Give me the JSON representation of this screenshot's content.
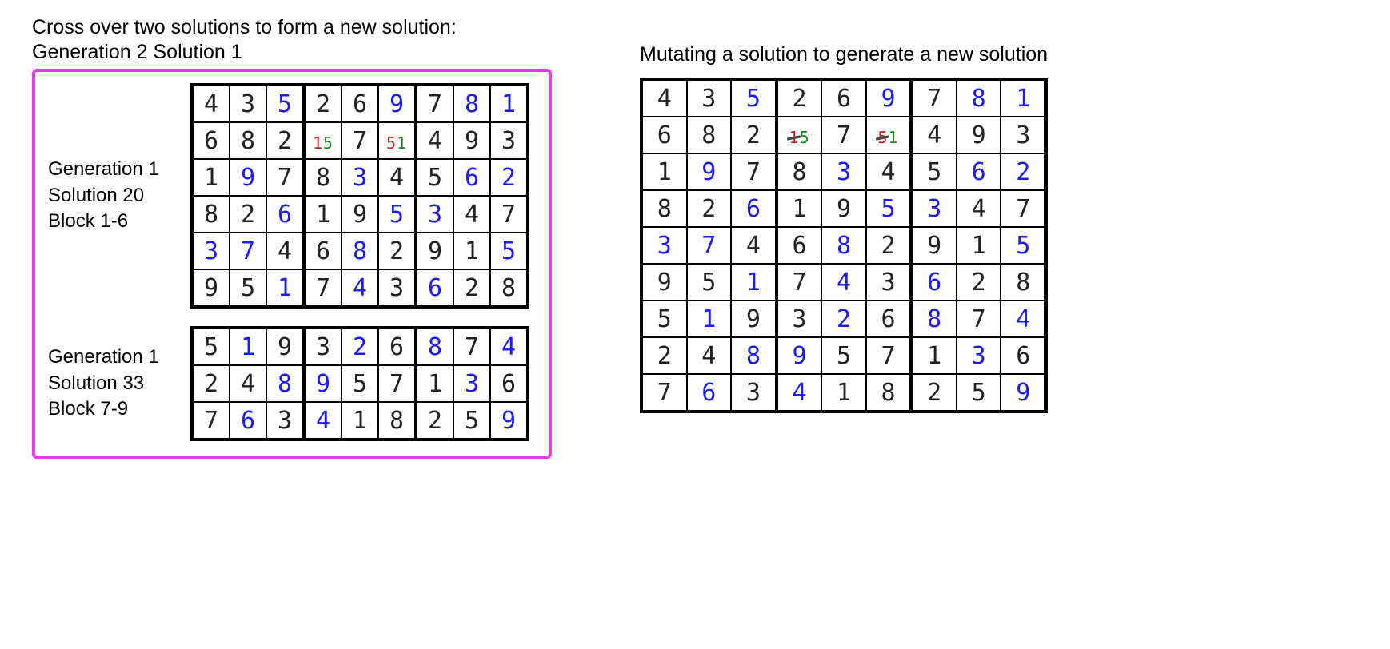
{
  "left": {
    "caption_line1": "Cross over two solutions to form a new solution:",
    "caption_line2": "Generation 2 Solution 1",
    "partA": {
      "label_l1": "Generation 1",
      "label_l2": "Solution 20",
      "label_l3": "Block 1-6",
      "rows": [
        [
          {
            "v": "4",
            "c": "k"
          },
          {
            "v": "3",
            "c": "k"
          },
          {
            "v": "5",
            "c": "b"
          },
          {
            "v": "2",
            "c": "k"
          },
          {
            "v": "6",
            "c": "k"
          },
          {
            "v": "9",
            "c": "b"
          },
          {
            "v": "7",
            "c": "k"
          },
          {
            "v": "8",
            "c": "b"
          },
          {
            "v": "1",
            "c": "b"
          }
        ],
        [
          {
            "v": "6",
            "c": "k"
          },
          {
            "v": "8",
            "c": "k"
          },
          {
            "v": "2",
            "c": "k"
          },
          {
            "mix": [
              {
                "t": "1",
                "c": "red"
              },
              {
                "t": "5",
                "c": "grn"
              }
            ]
          },
          {
            "v": "7",
            "c": "k"
          },
          {
            "mix": [
              {
                "t": "5",
                "c": "red"
              },
              {
                "t": "1",
                "c": "grn"
              }
            ]
          },
          {
            "v": "4",
            "c": "k"
          },
          {
            "v": "9",
            "c": "k"
          },
          {
            "v": "3",
            "c": "k"
          }
        ],
        [
          {
            "v": "1",
            "c": "k"
          },
          {
            "v": "9",
            "c": "b"
          },
          {
            "v": "7",
            "c": "k"
          },
          {
            "v": "8",
            "c": "k"
          },
          {
            "v": "3",
            "c": "b"
          },
          {
            "v": "4",
            "c": "k"
          },
          {
            "v": "5",
            "c": "k"
          },
          {
            "v": "6",
            "c": "b"
          },
          {
            "v": "2",
            "c": "b"
          }
        ],
        [
          {
            "v": "8",
            "c": "k"
          },
          {
            "v": "2",
            "c": "k"
          },
          {
            "v": "6",
            "c": "b"
          },
          {
            "v": "1",
            "c": "k"
          },
          {
            "v": "9",
            "c": "k"
          },
          {
            "v": "5",
            "c": "b"
          },
          {
            "v": "3",
            "c": "b"
          },
          {
            "v": "4",
            "c": "k"
          },
          {
            "v": "7",
            "c": "k"
          }
        ],
        [
          {
            "v": "3",
            "c": "b"
          },
          {
            "v": "7",
            "c": "b"
          },
          {
            "v": "4",
            "c": "k"
          },
          {
            "v": "6",
            "c": "k"
          },
          {
            "v": "8",
            "c": "b"
          },
          {
            "v": "2",
            "c": "k"
          },
          {
            "v": "9",
            "c": "k"
          },
          {
            "v": "1",
            "c": "k"
          },
          {
            "v": "5",
            "c": "b"
          }
        ],
        [
          {
            "v": "9",
            "c": "k"
          },
          {
            "v": "5",
            "c": "k"
          },
          {
            "v": "1",
            "c": "b"
          },
          {
            "v": "7",
            "c": "k"
          },
          {
            "v": "4",
            "c": "b"
          },
          {
            "v": "3",
            "c": "k"
          },
          {
            "v": "6",
            "c": "b"
          },
          {
            "v": "2",
            "c": "k"
          },
          {
            "v": "8",
            "c": "k"
          }
        ]
      ]
    },
    "partB": {
      "label_l1": "Generation 1",
      "label_l2": "Solution 33",
      "label_l3": "Block 7-9",
      "rows": [
        [
          {
            "v": "5",
            "c": "k"
          },
          {
            "v": "1",
            "c": "b"
          },
          {
            "v": "9",
            "c": "k"
          },
          {
            "v": "3",
            "c": "k"
          },
          {
            "v": "2",
            "c": "b"
          },
          {
            "v": "6",
            "c": "k"
          },
          {
            "v": "8",
            "c": "b"
          },
          {
            "v": "7",
            "c": "k"
          },
          {
            "v": "4",
            "c": "b"
          }
        ],
        [
          {
            "v": "2",
            "c": "k"
          },
          {
            "v": "4",
            "c": "k"
          },
          {
            "v": "8",
            "c": "b"
          },
          {
            "v": "9",
            "c": "b"
          },
          {
            "v": "5",
            "c": "k"
          },
          {
            "v": "7",
            "c": "k"
          },
          {
            "v": "1",
            "c": "k"
          },
          {
            "v": "3",
            "c": "b"
          },
          {
            "v": "6",
            "c": "k"
          }
        ],
        [
          {
            "v": "7",
            "c": "k"
          },
          {
            "v": "6",
            "c": "b"
          },
          {
            "v": "3",
            "c": "k"
          },
          {
            "v": "4",
            "c": "b"
          },
          {
            "v": "1",
            "c": "k"
          },
          {
            "v": "8",
            "c": "k"
          },
          {
            "v": "2",
            "c": "k"
          },
          {
            "v": "5",
            "c": "k"
          },
          {
            "v": "9",
            "c": "b"
          }
        ]
      ]
    }
  },
  "right": {
    "caption": "Mutating a solution to generate a new solution",
    "rows": [
      [
        {
          "v": "4",
          "c": "k"
        },
        {
          "v": "3",
          "c": "k"
        },
        {
          "v": "5",
          "c": "b"
        },
        {
          "v": "2",
          "c": "k"
        },
        {
          "v": "6",
          "c": "k"
        },
        {
          "v": "9",
          "c": "b"
        },
        {
          "v": "7",
          "c": "k"
        },
        {
          "v": "8",
          "c": "b"
        },
        {
          "v": "1",
          "c": "b"
        }
      ],
      [
        {
          "v": "6",
          "c": "k"
        },
        {
          "v": "8",
          "c": "k"
        },
        {
          "v": "2",
          "c": "k"
        },
        {
          "mix": [
            {
              "t": "1",
              "c": "red",
              "strike": true
            },
            {
              "t": "5",
              "c": "grn"
            }
          ]
        },
        {
          "v": "7",
          "c": "k"
        },
        {
          "mix": [
            {
              "t": "5",
              "c": "red",
              "strike": true
            },
            {
              "t": "1",
              "c": "grn"
            }
          ]
        },
        {
          "v": "4",
          "c": "k"
        },
        {
          "v": "9",
          "c": "k"
        },
        {
          "v": "3",
          "c": "k"
        }
      ],
      [
        {
          "v": "1",
          "c": "k"
        },
        {
          "v": "9",
          "c": "b"
        },
        {
          "v": "7",
          "c": "k"
        },
        {
          "v": "8",
          "c": "k"
        },
        {
          "v": "3",
          "c": "b"
        },
        {
          "v": "4",
          "c": "k"
        },
        {
          "v": "5",
          "c": "k"
        },
        {
          "v": "6",
          "c": "b"
        },
        {
          "v": "2",
          "c": "b"
        }
      ],
      [
        {
          "v": "8",
          "c": "k"
        },
        {
          "v": "2",
          "c": "k"
        },
        {
          "v": "6",
          "c": "b"
        },
        {
          "v": "1",
          "c": "k"
        },
        {
          "v": "9",
          "c": "k"
        },
        {
          "v": "5",
          "c": "b"
        },
        {
          "v": "3",
          "c": "b"
        },
        {
          "v": "4",
          "c": "k"
        },
        {
          "v": "7",
          "c": "k"
        }
      ],
      [
        {
          "v": "3",
          "c": "b"
        },
        {
          "v": "7",
          "c": "b"
        },
        {
          "v": "4",
          "c": "k"
        },
        {
          "v": "6",
          "c": "k"
        },
        {
          "v": "8",
          "c": "b"
        },
        {
          "v": "2",
          "c": "k"
        },
        {
          "v": "9",
          "c": "k"
        },
        {
          "v": "1",
          "c": "k"
        },
        {
          "v": "5",
          "c": "b"
        }
      ],
      [
        {
          "v": "9",
          "c": "k"
        },
        {
          "v": "5",
          "c": "k"
        },
        {
          "v": "1",
          "c": "b"
        },
        {
          "v": "7",
          "c": "k"
        },
        {
          "v": "4",
          "c": "b"
        },
        {
          "v": "3",
          "c": "k"
        },
        {
          "v": "6",
          "c": "b"
        },
        {
          "v": "2",
          "c": "k"
        },
        {
          "v": "8",
          "c": "k"
        }
      ],
      [
        {
          "v": "5",
          "c": "k"
        },
        {
          "v": "1",
          "c": "b"
        },
        {
          "v": "9",
          "c": "k"
        },
        {
          "v": "3",
          "c": "k"
        },
        {
          "v": "2",
          "c": "b"
        },
        {
          "v": "6",
          "c": "k"
        },
        {
          "v": "8",
          "c": "b"
        },
        {
          "v": "7",
          "c": "k"
        },
        {
          "v": "4",
          "c": "b"
        }
      ],
      [
        {
          "v": "2",
          "c": "k"
        },
        {
          "v": "4",
          "c": "k"
        },
        {
          "v": "8",
          "c": "b"
        },
        {
          "v": "9",
          "c": "b"
        },
        {
          "v": "5",
          "c": "k"
        },
        {
          "v": "7",
          "c": "k"
        },
        {
          "v": "1",
          "c": "k"
        },
        {
          "v": "3",
          "c": "b"
        },
        {
          "v": "6",
          "c": "k"
        }
      ],
      [
        {
          "v": "7",
          "c": "k"
        },
        {
          "v": "6",
          "c": "b"
        },
        {
          "v": "3",
          "c": "k"
        },
        {
          "v": "4",
          "c": "b"
        },
        {
          "v": "1",
          "c": "k"
        },
        {
          "v": "8",
          "c": "k"
        },
        {
          "v": "2",
          "c": "k"
        },
        {
          "v": "5",
          "c": "k"
        },
        {
          "v": "9",
          "c": "b"
        }
      ]
    ]
  }
}
